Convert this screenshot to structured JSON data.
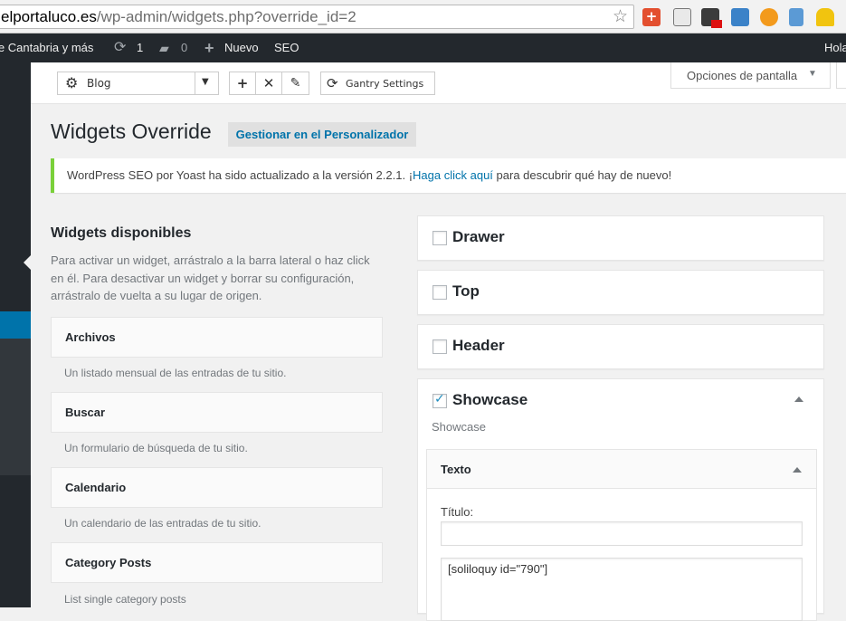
{
  "browser": {
    "url_host": "elportaluco.es",
    "url_path": "/wp-admin/widgets.php?override_id=2"
  },
  "adminbar": {
    "site_name": "le Cantabria y más",
    "updates_count": "1",
    "comments_count": "0",
    "new_label": "Nuevo",
    "seo_label": "SEO",
    "greeting": "Hola"
  },
  "toolbar": {
    "override_select": "Blog",
    "gantry_settings": "Gantry Settings",
    "screen_options": "Opciones de pantalla"
  },
  "page": {
    "title": "Widgets Override",
    "manage_button": "Gestionar en el Personalizador"
  },
  "notice": {
    "before": "WordPress SEO por Yoast ha sido actualizado a la versión 2.2.1. ¡",
    "link": "Haga click aquí",
    "after": " para descubrir qué hay de nuevo!"
  },
  "available": {
    "title": "Widgets disponibles",
    "description": "Para activar un widget, arrástralo a la barra lateral o haz click en él. Para desactivar un widget y borrar su configuración, arrástralo de vuelta a su lugar de origen.",
    "widgets": [
      {
        "name": "Archivos",
        "desc": "Un listado mensual de las entradas de tu sitio."
      },
      {
        "name": "Buscar",
        "desc": "Un formulario de búsqueda de tu sitio."
      },
      {
        "name": "Calendario",
        "desc": "Un calendario de las entradas de tu sitio."
      },
      {
        "name": "Category Posts",
        "desc": "List single category posts"
      }
    ]
  },
  "sidebars": [
    {
      "name": "Drawer",
      "checked": false
    },
    {
      "name": "Top",
      "checked": false
    },
    {
      "name": "Header",
      "checked": false
    },
    {
      "name": "Showcase",
      "checked": true,
      "description": "Showcase"
    }
  ],
  "text_widget": {
    "header": "Texto",
    "title_label": "Título:",
    "title_value": "",
    "content": "[soliloquy id=\"790\"]"
  },
  "colors": {
    "admin_dark": "#23282d",
    "accent_blue": "#0073aa",
    "notice_green": "#7ad03a"
  }
}
